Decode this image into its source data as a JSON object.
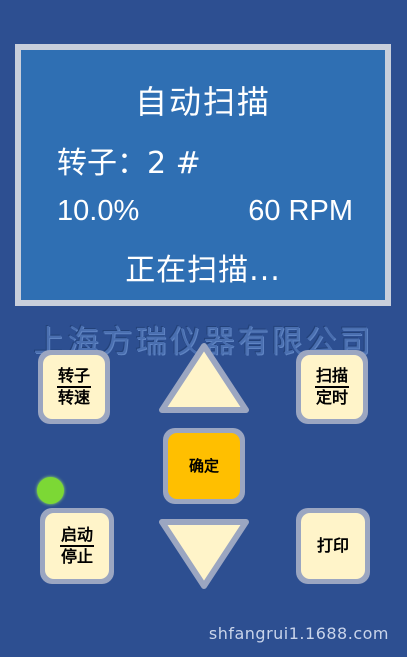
{
  "lcd": {
    "title": "自动扫描",
    "rotor_line": "转子：2 #",
    "percent": "10.0%",
    "rpm": "60 RPM",
    "status": "正在扫描..."
  },
  "company": "上海方瑞仪器有限公司",
  "keys": {
    "rotor_speed": {
      "line1": "转子",
      "line2": "转速"
    },
    "scan_timer": {
      "line1": "扫描",
      "line2": "定时"
    },
    "start_stop": {
      "line1": "启动",
      "line2": "停止"
    },
    "print": "打印",
    "confirm": "确定"
  },
  "footer": "shfangrui1.1688.com",
  "colors": {
    "panel": "#2d4f91",
    "lcd_background": "#2f6fb3",
    "key_face": "#fff4c9",
    "confirm_key": "#ffbf00",
    "led": "#7cd835"
  },
  "icons": {
    "up": "up-arrow-icon",
    "down": "down-arrow-icon"
  }
}
